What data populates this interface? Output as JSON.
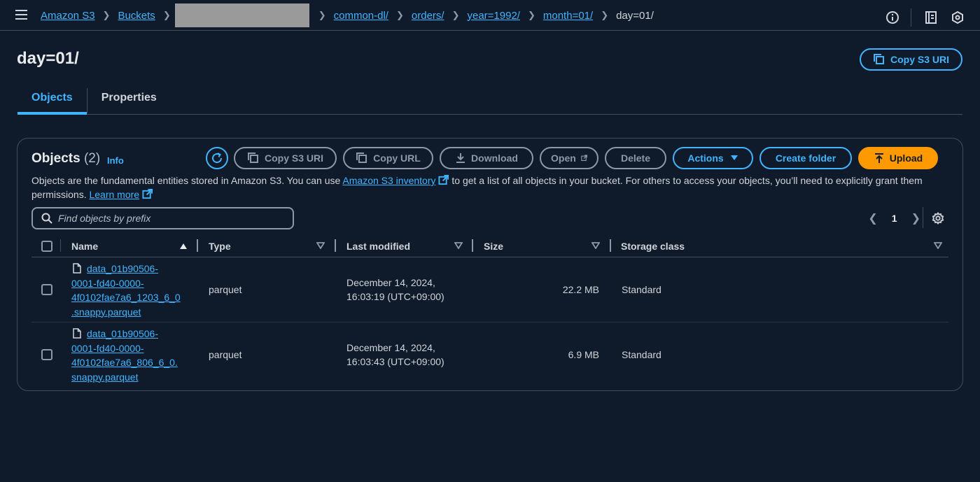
{
  "breadcrumbs": [
    "Amazon S3",
    "Buckets",
    "common-dl/",
    "orders/",
    "year=1992/",
    "month=01/"
  ],
  "breadcrumb_current": "day=01/",
  "page": {
    "title": "day=01/",
    "copy_uri_label": "Copy S3 URI"
  },
  "tabs": [
    "Objects",
    "Properties"
  ],
  "objects": {
    "title": "Objects",
    "count": "(2)",
    "info": "Info",
    "toolbar": {
      "copy_s3_uri": "Copy S3 URI",
      "copy_url": "Copy URL",
      "download": "Download",
      "open": "Open",
      "delete": "Delete",
      "actions": "Actions",
      "create_folder": "Create folder",
      "upload": "Upload"
    },
    "description": {
      "part1": "Objects are the fundamental entities stored in Amazon S3. You can use ",
      "inventory_link": "Amazon S3 inventory",
      "part2": " to get a list of all objects in your bucket. For others to access your objects, you’ll need to explicitly grant them permissions. ",
      "learn_more": "Learn more"
    },
    "search_placeholder": "Find objects by prefix",
    "page_number": "1",
    "columns": {
      "name": "Name",
      "type": "Type",
      "last_modified": "Last modified",
      "size": "Size",
      "storage_class": "Storage class"
    },
    "rows": [
      {
        "name_lines": [
          "data_01b90506-",
          "0001-fd40-0000-",
          "4f0102fae7a6_1203_6_0",
          ".snappy.parquet"
        ],
        "type": "parquet",
        "modified_date": "December 14, 2024,",
        "modified_time": "16:03:19 (UTC+09:00)",
        "size": "22.2 MB",
        "storage_class": "Standard"
      },
      {
        "name_lines": [
          "data_01b90506-",
          "0001-fd40-0000-",
          "4f0102fae7a6_806_6_0.",
          "snappy.parquet"
        ],
        "type": "parquet",
        "modified_date": "December 14, 2024,",
        "modified_time": "16:03:43 (UTC+09:00)",
        "size": "6.9 MB",
        "storage_class": "Standard"
      }
    ]
  },
  "colors": {
    "background": "#0f1b2a",
    "link": "#42b4ff",
    "primary": "#ff9900",
    "border": "#414d5c"
  }
}
